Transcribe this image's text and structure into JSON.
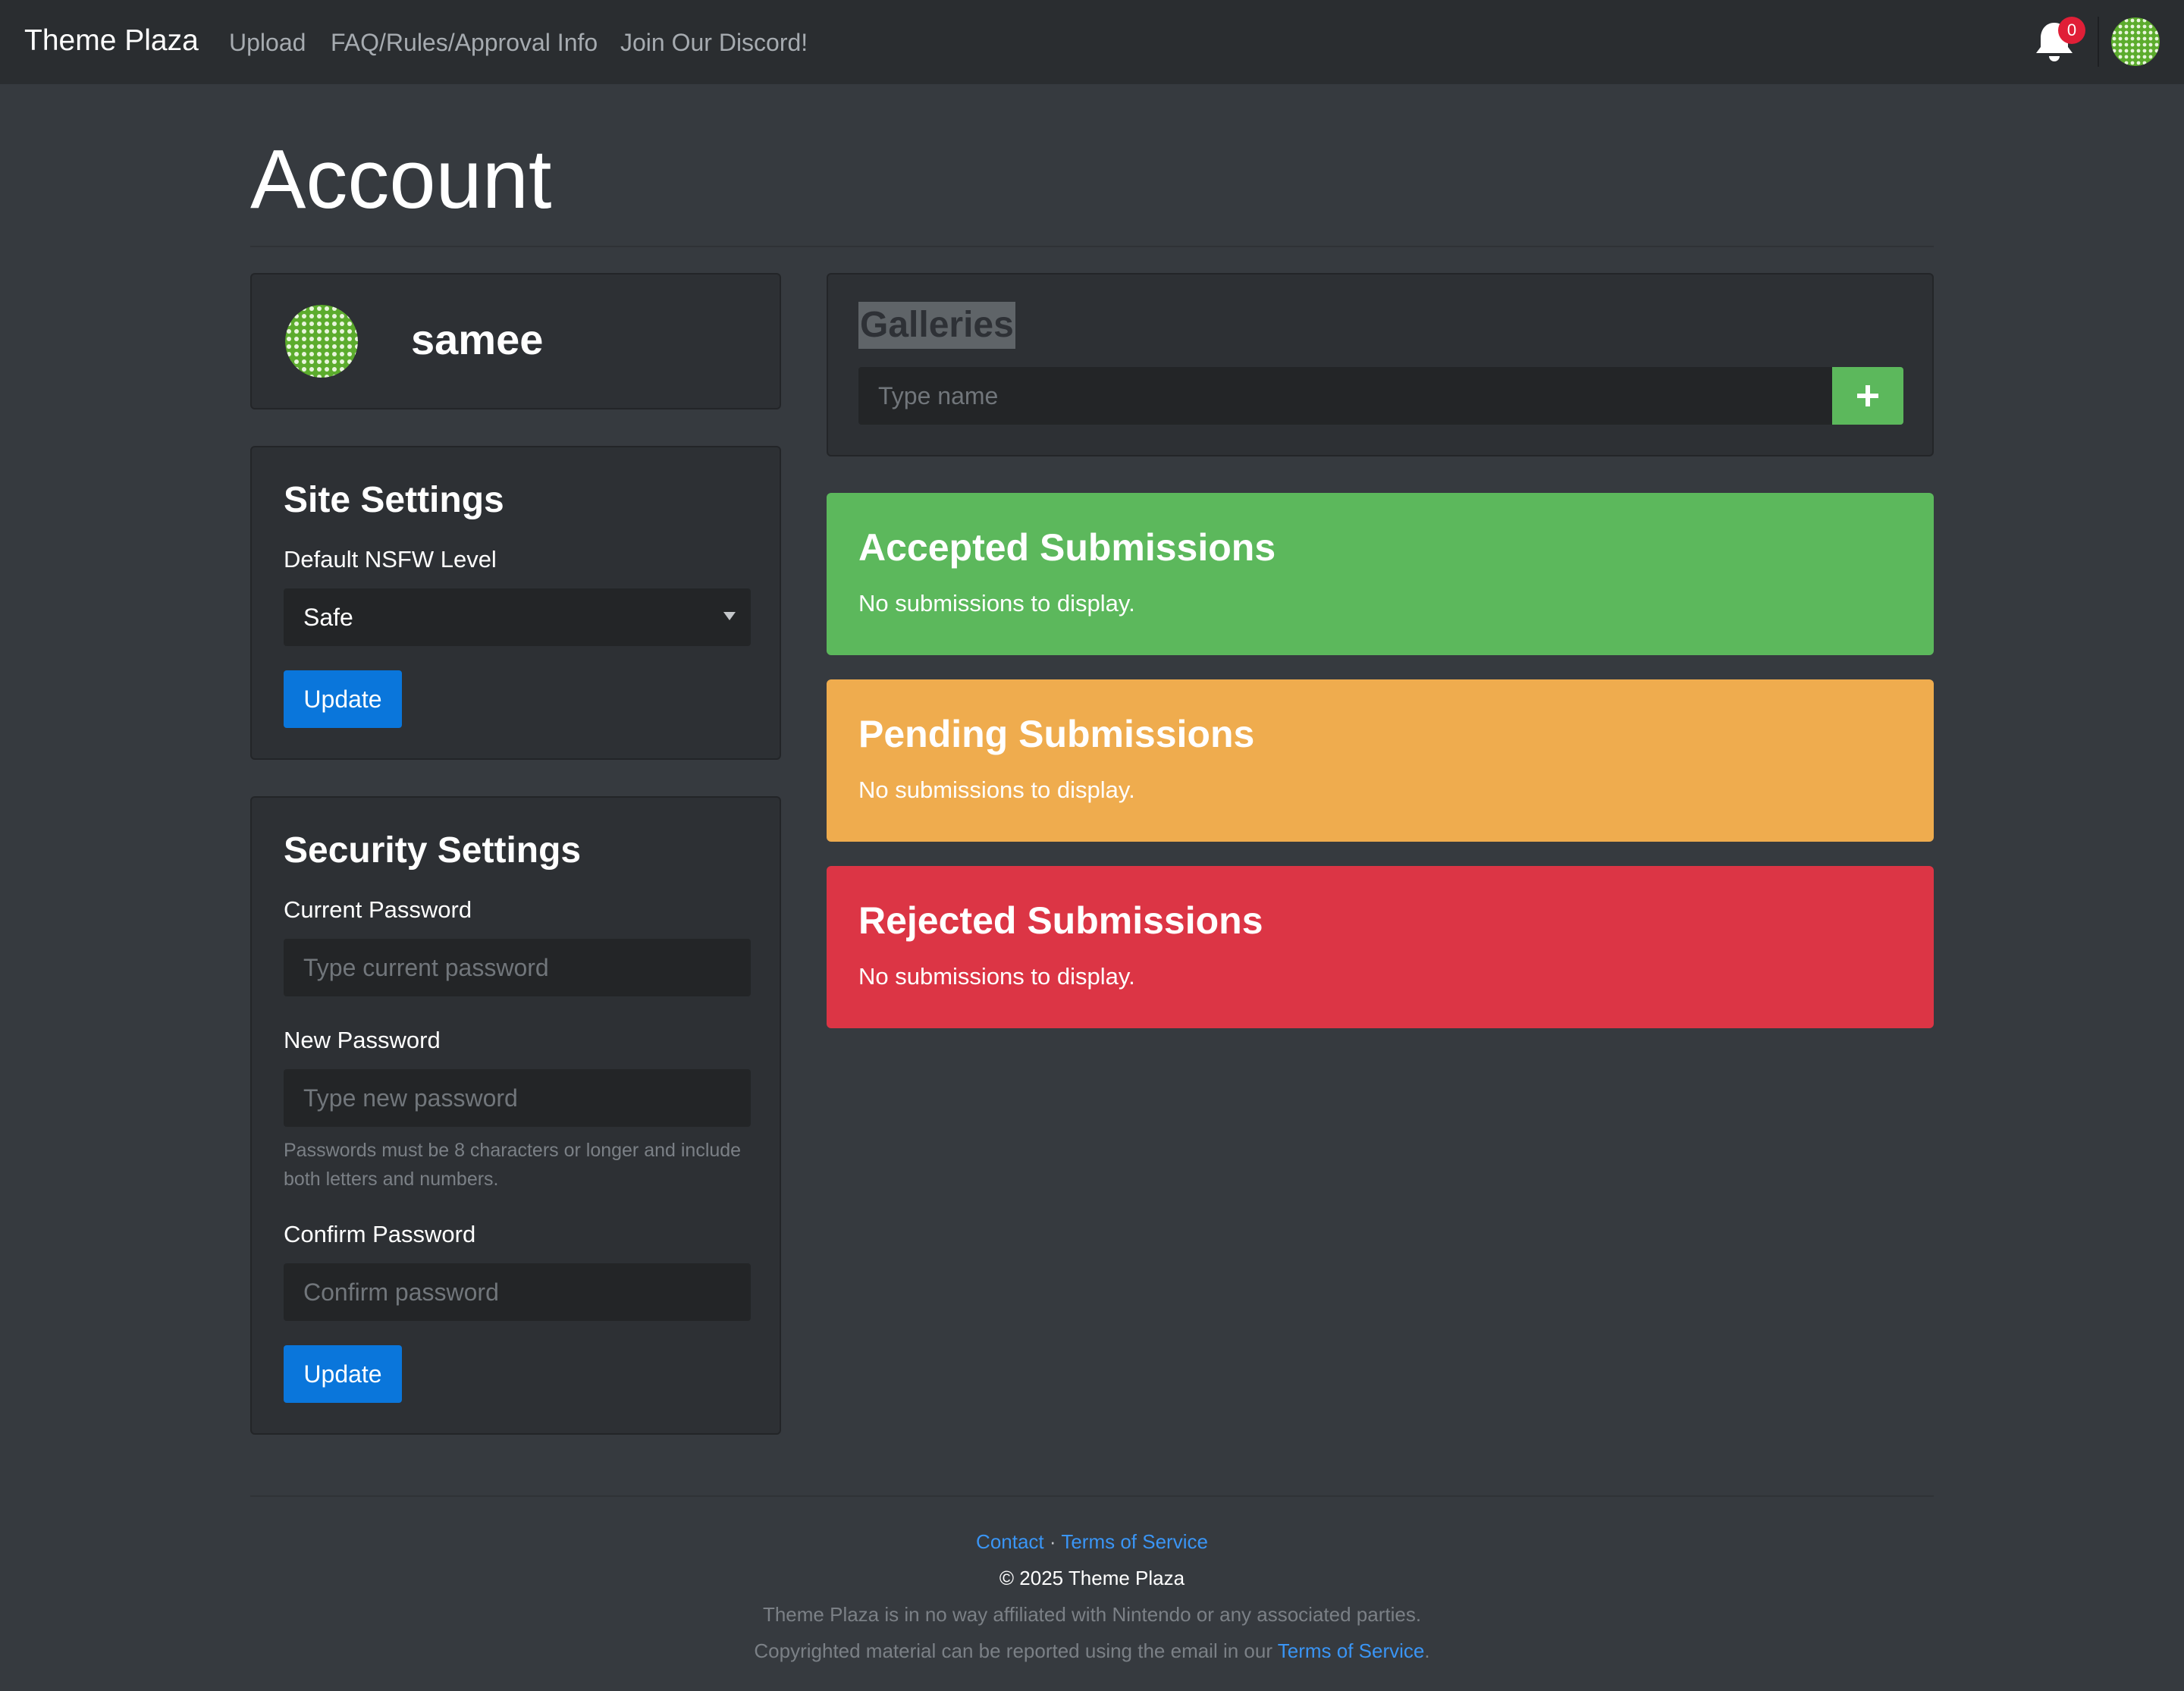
{
  "navbar": {
    "brand": "Theme Plaza",
    "links": [
      "Upload",
      "FAQ/Rules/Approval Info",
      "Join Our Discord!"
    ],
    "notification_count": "0",
    "icons": {
      "notifications": "bell-icon",
      "account": "avatar"
    }
  },
  "page": {
    "title": "Account"
  },
  "profile": {
    "username": "samee"
  },
  "site_settings": {
    "title": "Site Settings",
    "nsfw_label": "Default NSFW Level",
    "nsfw_value": "Safe",
    "update_label": "Update"
  },
  "security_settings": {
    "title": "Security Settings",
    "current_label": "Current Password",
    "current_placeholder": "Type current password",
    "new_label": "New Password",
    "new_placeholder": "Type new password",
    "help": "Passwords must be 8 characters or longer and include both letters and numbers.",
    "confirm_label": "Confirm Password",
    "confirm_placeholder": "Confirm password",
    "update_label": "Update"
  },
  "galleries": {
    "title": "Galleries",
    "placeholder": "Type name",
    "add_icon": "plus-icon"
  },
  "submissions": {
    "accepted": {
      "title": "Accepted Submissions",
      "body": "No submissions to display."
    },
    "pending": {
      "title": "Pending Submissions",
      "body": "No submissions to display."
    },
    "rejected": {
      "title": "Rejected Submissions",
      "body": "No submissions to display."
    }
  },
  "footer": {
    "contact": "Contact",
    "separator": "·",
    "tos": "Terms of Service",
    "copyright": "© 2025 Theme Plaza",
    "disclaimer": "Theme Plaza is in no way affiliated with Nintendo or any associated parties.",
    "report_prefix": "Copyrighted material can be reported using the email in our ",
    "report_link": "Terms of Service",
    "report_suffix": "."
  },
  "colors": {
    "background": "#363a3f",
    "navbar": "#2a2d30",
    "panel": "#2d3034",
    "primary": "#0a76db",
    "success": "#5cb85c",
    "warning": "#efac4e",
    "danger": "#dc3545",
    "link": "#3a95f5"
  }
}
